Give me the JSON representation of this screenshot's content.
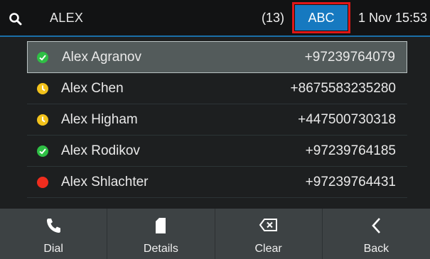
{
  "header": {
    "search_text": "ALEX",
    "result_count": "(13)",
    "input_mode": "ABC",
    "datetime": "1 Nov 15:53"
  },
  "contacts": [
    {
      "name": "Alex Agranov",
      "phone": "+97239764079",
      "status": "available",
      "selected": true
    },
    {
      "name": "Alex Chen",
      "phone": "+8675583235280",
      "status": "away",
      "selected": false
    },
    {
      "name": "Alex Higham",
      "phone": "+447500730318",
      "status": "away",
      "selected": false
    },
    {
      "name": "Alex Rodikov",
      "phone": "+97239764185",
      "status": "available",
      "selected": false
    },
    {
      "name": "Alex Shlachter",
      "phone": "+97239764431",
      "status": "busy",
      "selected": false
    }
  ],
  "softkeys": [
    {
      "label": "Dial",
      "icon": "phone-icon"
    },
    {
      "label": "Details",
      "icon": "document-icon"
    },
    {
      "label": "Clear",
      "icon": "backspace-icon"
    },
    {
      "label": "Back",
      "icon": "chevron-left-icon"
    }
  ],
  "colors": {
    "accent": "#1679c0",
    "highlight_border": "#e01717",
    "status_available": "#2fbf45",
    "status_away": "#f2c21b",
    "status_busy": "#f02d1e"
  }
}
